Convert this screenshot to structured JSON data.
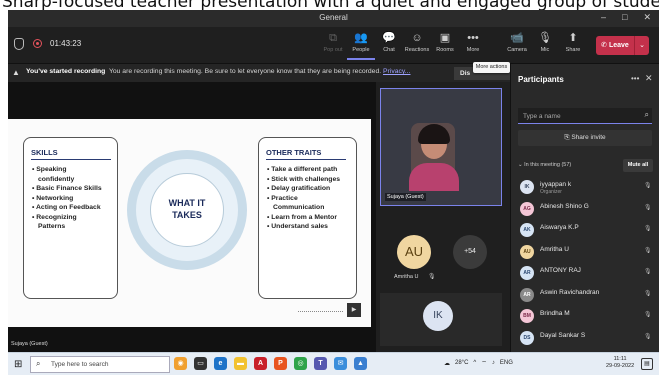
{
  "caption_text": "Sharp-focused teacher presentation with a quiet and engaged group of students",
  "window": {
    "title": "General",
    "buttons": [
      "–",
      "□",
      "✕"
    ]
  },
  "toolbar": {
    "timer": "01:43:23",
    "buttons": [
      {
        "label": "Pop out",
        "icon": "⧉"
      },
      {
        "label": "People",
        "icon": "👥"
      },
      {
        "label": "Chat",
        "icon": "💬"
      },
      {
        "label": "Reactions",
        "icon": "☺"
      },
      {
        "label": "Rooms",
        "icon": "▣"
      },
      {
        "label": "More",
        "icon": "•••"
      },
      {
        "label": "Camera",
        "icon": "📹"
      },
      {
        "label": "Mic",
        "icon": "🎙"
      },
      {
        "label": "Share",
        "icon": "⬆"
      }
    ],
    "leave_label": "Leave",
    "leave_color": "#c4314b"
  },
  "banner": {
    "bold": "You've started recording",
    "message": "You are recording this meeting. Be sure to let everyone know that they are being recorded.",
    "link": "Privacy...",
    "dismiss_label": "Dis",
    "tooltip": "More actions"
  },
  "slide": {
    "left_title": "SKILLS",
    "left_items": [
      "• Speaking",
      "  confidently",
      "• Basic Finance Skills",
      "• Networking",
      "• Acting on Feedback",
      "• Recognizing",
      "  Patterns"
    ],
    "center_line1": "WHAT IT",
    "center_line2": "TAKES",
    "right_title": "OTHER TRAITS",
    "right_items": [
      "• Take a different path",
      "• Stick with challenges",
      "• Delay gratification",
      "• Practice",
      "  Communication",
      "• Learn from a Mentor",
      "• Understand sales"
    ],
    "presenter_label": "Sujaya (Guest)"
  },
  "videos": {
    "main_name": "Sujaya (Guest)",
    "au_initials": "AU",
    "au_name": "Amritha U",
    "overflow": "+54",
    "ik_initials": "IK"
  },
  "participants": {
    "title": "Participants",
    "search_placeholder": "Type a name",
    "share_invite": "Share invite",
    "in_meeting": "In this meeting (57)",
    "mute_all": "Mute all",
    "list": [
      {
        "initials": "IK",
        "name": "iyyappan k",
        "role": "Organizer",
        "bg": "#dce4f2",
        "fg": "#34425c"
      },
      {
        "initials": "AG",
        "name": "Abinesh Shino G",
        "role": "",
        "bg": "#f4c6d6",
        "fg": "#7a2848"
      },
      {
        "initials": "AK",
        "name": "Aiswarya K.P",
        "role": "",
        "bg": "#d6e4f5",
        "fg": "#2a4770"
      },
      {
        "initials": "AU",
        "name": "Amritha U",
        "role": "",
        "bg": "#f0d6a0",
        "fg": "#5a4010"
      },
      {
        "initials": "AR",
        "name": "ANTONY RAJ",
        "role": "",
        "bg": "#d6e4f5",
        "fg": "#2a4770"
      },
      {
        "initials": "AR",
        "name": "Aswin Ravichandran",
        "role": "",
        "bg": "#8a8a8a",
        "fg": "#ffffff"
      },
      {
        "initials": "BM",
        "name": "Brindha M",
        "role": "",
        "bg": "#f4c6d6",
        "fg": "#7a2848"
      },
      {
        "initials": "DS",
        "name": "Dayal Sankar S",
        "role": "",
        "bg": "#d6e4f5",
        "fg": "#2a4770"
      }
    ]
  },
  "taskbar": {
    "search_placeholder": "Type here to search",
    "weather": "28°C",
    "lang": "ENG",
    "time": "11:11",
    "date": "29-09-2022"
  }
}
